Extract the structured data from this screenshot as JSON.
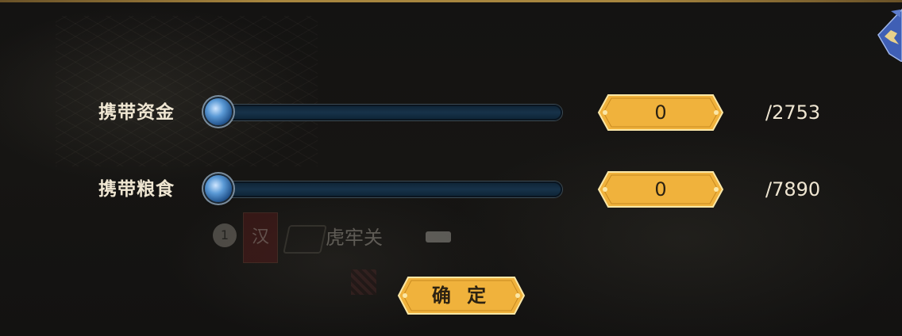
{
  "rows": [
    {
      "label": "携带资金",
      "value": "0",
      "max": "/2753",
      "fraction": 0
    },
    {
      "label": "携带粮食",
      "value": "0",
      "max": "/7890",
      "fraction": 0
    }
  ],
  "confirm_label": "确 定",
  "background": {
    "flag_text": "汉",
    "coin_text": "1",
    "city_name": "虎牢关"
  },
  "colors": {
    "gold": "#f0b23c",
    "gold_border": "#fbe7a6",
    "track": "#173249",
    "label": "#efe6d2"
  },
  "icons": {
    "corner": "bird-flag-icon",
    "knob": "slider-knob-orb-icon"
  }
}
